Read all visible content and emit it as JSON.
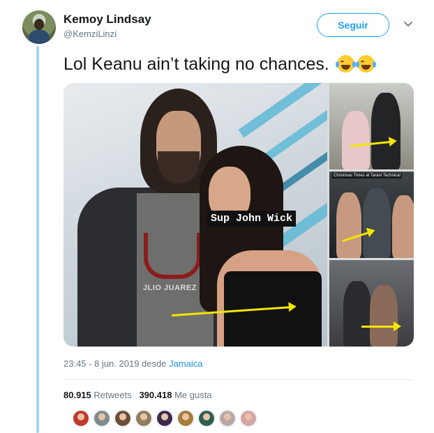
{
  "user": {
    "name": "Kemoy Lindsay",
    "handle": "@KemziLinzi"
  },
  "actions": {
    "follow_label": "Seguir"
  },
  "tweet": {
    "text": "Lol Keanu ain’t taking no chances.",
    "emojis": [
      "face-with-tears-of-joy-icon",
      "face-with-tears-of-joy-icon"
    ],
    "timestamp": "23:45 - 8 jun. 2019 desde",
    "location": "Jamaica"
  },
  "media": {
    "sticker_text": "Sup John Wick",
    "shirt_text": "JLIO JUAREZ",
    "mini_caption": "Christmas Times at Tarani Technical"
  },
  "stats": {
    "retweets_count": "80.915",
    "retweets_label": "Retweets",
    "likes_count": "390.418",
    "likes_label": "Me gusta"
  },
  "likers": [
    {
      "icon": "avatar",
      "color": "#c0392b"
    },
    {
      "icon": "avatar",
      "color": "#7f8c8d"
    },
    {
      "icon": "avatar",
      "color": "#6b4f3a"
    },
    {
      "icon": "avatar",
      "color": "#8e7f5d"
    },
    {
      "icon": "avatar",
      "color": "#3d2b4f"
    },
    {
      "icon": "avatar",
      "color": "#a57d3c"
    },
    {
      "icon": "avatar",
      "color": "#2f5d50"
    },
    {
      "icon": "avatar",
      "color": "#b9a8a8"
    },
    {
      "icon": "avatar",
      "color": "#d4a5a5"
    }
  ],
  "colors": {
    "accent": "#1da1f2",
    "thread_line": "#a6d3f0",
    "arrow": "#f2e600"
  }
}
